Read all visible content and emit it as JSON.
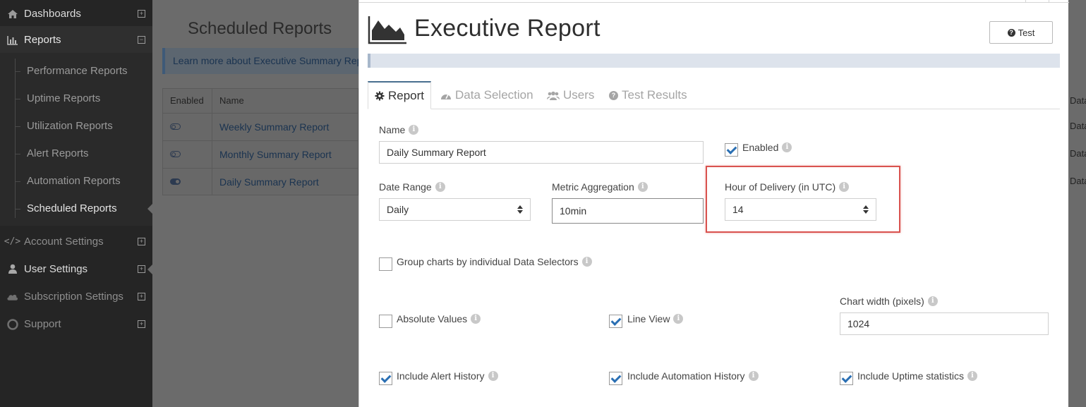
{
  "sidebar": {
    "dashboards": "Dashboards",
    "reports": "Reports",
    "sub_items": [
      "Performance Reports",
      "Uptime Reports",
      "Utilization Reports",
      "Alert Reports",
      "Automation Reports",
      "Scheduled Reports"
    ],
    "account_settings": "Account Settings",
    "user_settings": "User Settings",
    "subscription_settings": "Subscription Settings",
    "support": "Support"
  },
  "background": {
    "title": "Scheduled Reports",
    "banner": "Learn more about Executive Summary Reports",
    "table": {
      "headers": [
        "Enabled",
        "Name"
      ],
      "rows": [
        {
          "enabled": false,
          "name": "Weekly Summary Report"
        },
        {
          "enabled": false,
          "name": "Monthly Summary Report"
        },
        {
          "enabled": true,
          "name": "Daily Summary Report"
        }
      ]
    },
    "right_column": [
      "Data",
      "Data",
      "Data",
      "Data"
    ]
  },
  "modal": {
    "title": "Executive Report",
    "test_button": "Test",
    "tabs": [
      "Report",
      "Data Selection",
      "Users",
      "Test Results"
    ],
    "form": {
      "name_label": "Name",
      "name_value": "Daily Summary Report",
      "enabled_label": "Enabled",
      "enabled_checked": true,
      "date_range_label": "Date Range",
      "date_range_value": "Daily",
      "metric_aggregation_label": "Metric Aggregation",
      "metric_aggregation_value": "10min",
      "hour_of_delivery_label": "Hour of Delivery (in UTC)",
      "hour_of_delivery_value": "14",
      "group_charts_label": "Group charts by individual Data Selectors",
      "group_charts_checked": false,
      "absolute_values_label": "Absolute Values",
      "absolute_values_checked": false,
      "line_view_label": "Line View",
      "line_view_checked": true,
      "chart_width_label": "Chart width (pixels)",
      "chart_width_value": "1024",
      "include_alert_history_label": "Include Alert History",
      "include_alert_history_checked": true,
      "include_automation_history_label": "Include Automation History",
      "include_automation_history_checked": true,
      "include_uptime_label": "Include Uptime statistics",
      "include_uptime_checked": true
    }
  },
  "colors": {
    "sidebar_bg": "#252525",
    "overlay": "#6b6b6b",
    "accent": "#2a6fb3",
    "highlight_border": "#d9534f"
  }
}
